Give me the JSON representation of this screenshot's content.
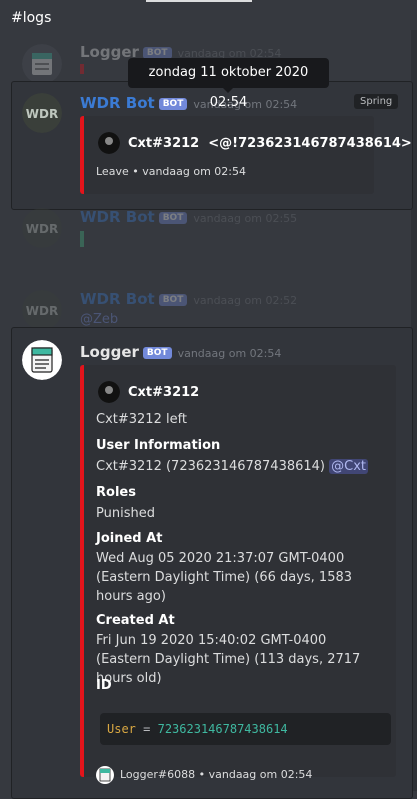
{
  "channel": "#logs",
  "tooltip": "zondag 11 oktober 2020 02:54",
  "bot_badge": "BOT",
  "accent": "#e3141b",
  "messages": [
    {
      "user": "Logger",
      "time": "vandaag om 02:54"
    },
    {
      "user": "WDR Bot",
      "time": "vandaag om 02:54",
      "role_tag": "Spring",
      "embed": {
        "author": "Cxt#3212",
        "mention": "<@!723623146787438614>",
        "footer": "Leave • vandaag om 02:54"
      }
    },
    {
      "user": "WDR Bot",
      "time": "vandaag om 02:55"
    },
    {
      "user": "WDR Bot",
      "time": "vandaag om 02:52",
      "snippet": "@Zeb"
    },
    {
      "user": "Logger",
      "time": "vandaag om 02:54",
      "embed": {
        "author": "Cxt#3212",
        "description": "Cxt#3212 left",
        "fields": [
          {
            "name": "User Information",
            "value": "Cxt#3212 (723623146787438614)",
            "mention": "@Cxt"
          },
          {
            "name": "Roles",
            "value": "Punished"
          },
          {
            "name": "Joined At",
            "value": "Wed Aug 05 2020 21:37:07 GMT-0400 (Eastern Daylight Time) (66 days, 1583 hours ago)"
          },
          {
            "name": "Created At",
            "value": "Fri Jun 19 2020 15:40:02 GMT-0400 (Eastern Daylight Time) (113 days, 2717 hours old)"
          },
          {
            "name": "ID",
            "code_key": "User",
            "code_op": "=",
            "code_val": "723623146787438614"
          }
        ],
        "footer": "Logger#6088 • vandaag om 02:54"
      }
    }
  ]
}
